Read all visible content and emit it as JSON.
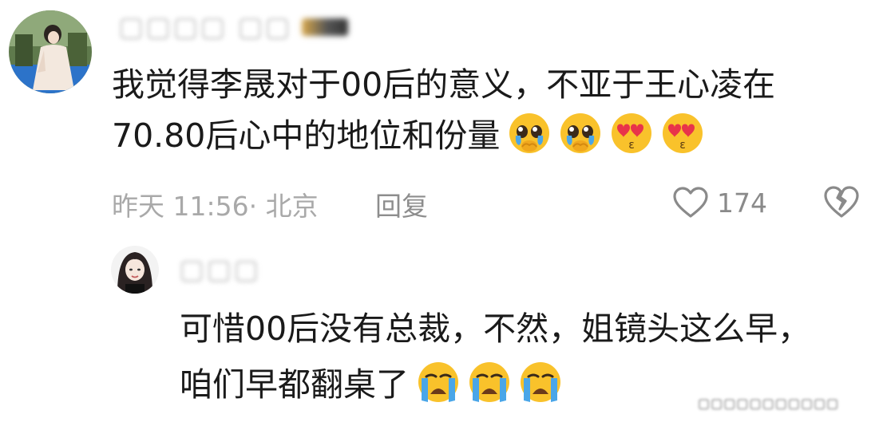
{
  "comment": {
    "username": "▢▢▢▢ ▢▢",
    "text_line1": "我觉得李晟对于00后的意义，不亚于王心凌在",
    "text_line2": "70.80后心中的地位和份量",
    "emojis": [
      "pleading-face-emoji",
      "pleading-face-emoji",
      "heart-eyes-kiss-emoji",
      "heart-eyes-kiss-emoji"
    ],
    "timestamp": "昨天 11:56· 北京",
    "reply_label": "回复",
    "like_count": "174"
  },
  "reply": {
    "username": "▢▢▢",
    "text_line1": "可惜00后没有总裁，不然，姐镜头这么早，",
    "text_line2": "咱们早都翻桌了",
    "emojis": [
      "crying-face-emoji",
      "crying-face-emoji",
      "crying-face-emoji"
    ]
  },
  "watermark": {
    "text": "▢▢▢▢▢▢▢▢▢▢▢"
  },
  "colors": {
    "text": "#1a1a1a",
    "meta": "#a9a9a9",
    "emoji_yellow": "#f9c22b",
    "tear_blue": "#4aa6e8",
    "heart_red": "#e8344a"
  }
}
